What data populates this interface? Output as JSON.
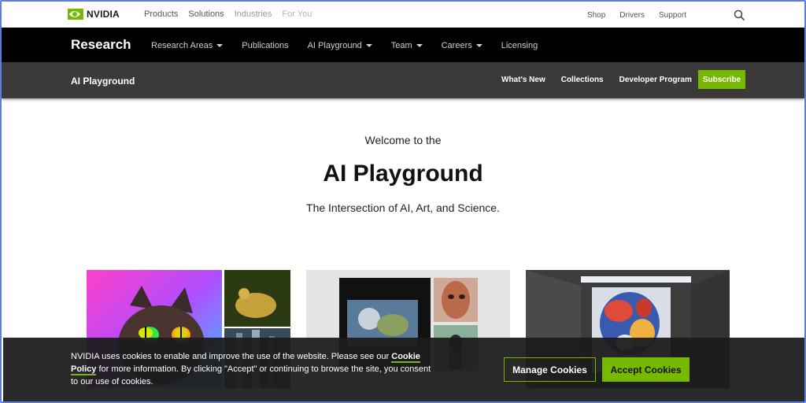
{
  "topbar": {
    "logo_text": "NVIDIA",
    "nav": [
      "Products",
      "Solutions",
      "Industries",
      "For You"
    ],
    "right_nav": [
      "Shop",
      "Drivers",
      "Support"
    ]
  },
  "research_bar": {
    "title": "Research",
    "items": [
      {
        "label": "Research Areas",
        "dropdown": true
      },
      {
        "label": "Publications",
        "dropdown": false
      },
      {
        "label": "AI Playground",
        "dropdown": true
      },
      {
        "label": "Team",
        "dropdown": true
      },
      {
        "label": "Careers",
        "dropdown": true
      },
      {
        "label": "Licensing",
        "dropdown": false
      }
    ]
  },
  "sub_bar": {
    "title": "AI Playground",
    "items": [
      "What's New",
      "Collections",
      "Developer Program"
    ],
    "subscribe_label": "Subscribe"
  },
  "hero": {
    "welcome": "Welcome to the",
    "title": "AI Playground",
    "subtitle": "The Intersection of AI, Art, and Science."
  },
  "cookie": {
    "text_before": "NVIDIA uses cookies to enable and improve the use of the website. Please see our ",
    "link": "Cookie Policy",
    "text_after": " for more information. By clicking \"Accept\" or continuing to browse the site, you consent to our use of cookies.",
    "manage_label": "Manage Cookies",
    "accept_label": "Accept Cookies"
  },
  "colors": {
    "brand_green": "#76b900",
    "research_bar": "#000000",
    "sub_bar": "#3a3a3a"
  }
}
